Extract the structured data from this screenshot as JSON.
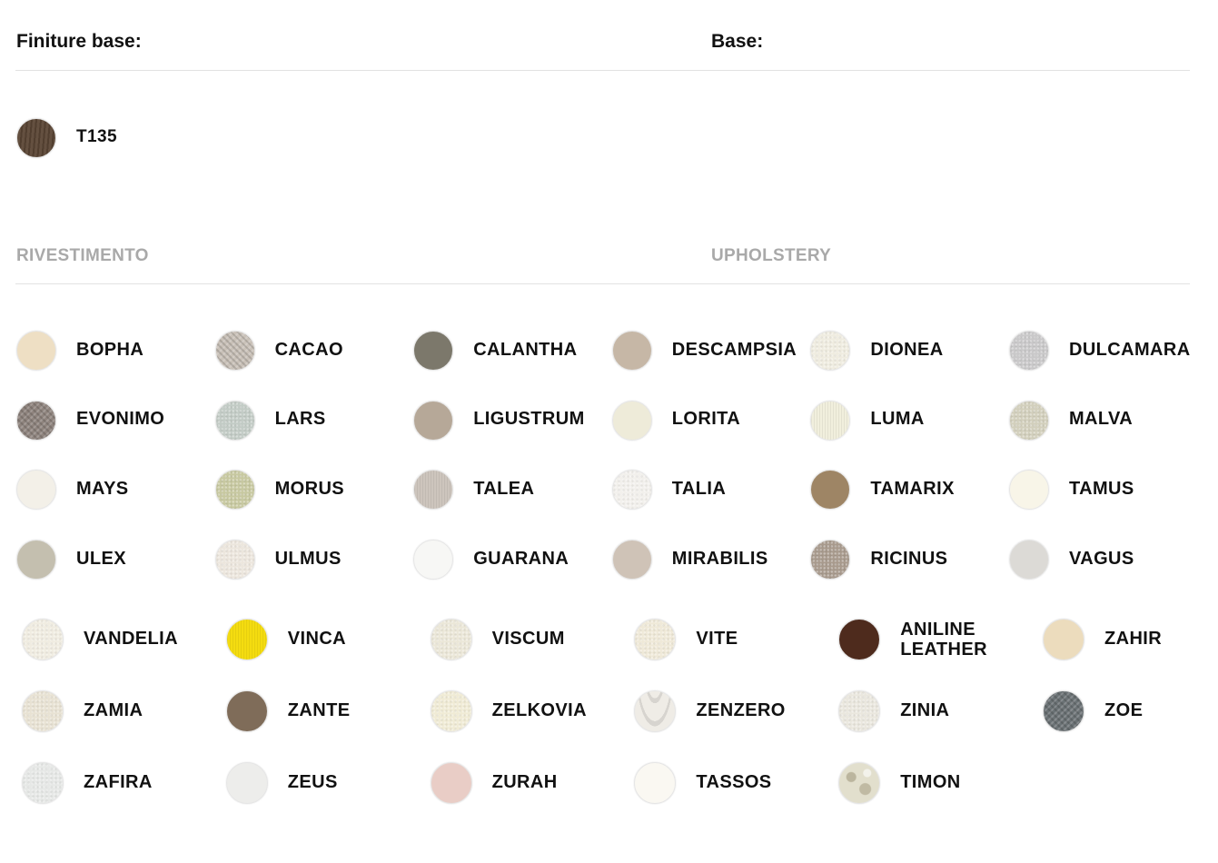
{
  "headers": {
    "finiture_base": "Finiture base:",
    "base": "Base:",
    "rivestimento": "RIVESTIMENTO",
    "upholstery": "UPHOLSTERY"
  },
  "base_finishes": [
    {
      "name": "T135",
      "color": "#5a4534",
      "texture": "wood"
    }
  ],
  "upholstery_group_a": [
    {
      "name": "BOPHA",
      "color": "#eedfc4"
    },
    {
      "name": "CACAO",
      "color": "#c9c1b8",
      "texture": "weave"
    },
    {
      "name": "CALANTHA",
      "color": "#7c786b"
    },
    {
      "name": "DESCAMPSIA",
      "color": "#c6b7a6"
    },
    {
      "name": "DIONEA",
      "color": "#efece0",
      "texture": "speckle"
    },
    {
      "name": "DULCAMARA",
      "color": "#c9c8c9",
      "texture": "speckle"
    },
    {
      "name": "EVONIMO",
      "color": "#8f847e",
      "texture": "weave"
    },
    {
      "name": "LARS",
      "color": "#c2cbc5",
      "texture": "speckle"
    },
    {
      "name": "LIGUSTRUM",
      "color": "#b6a898"
    },
    {
      "name": "LORITA",
      "color": "#eeebd9"
    },
    {
      "name": "LUMA",
      "color": "#f1efdd",
      "texture": "lines"
    },
    {
      "name": "MALVA",
      "color": "#d2cfbc",
      "texture": "speckle"
    },
    {
      "name": "MAYS",
      "color": "#f3f0e8"
    },
    {
      "name": "MORUS",
      "color": "#c7c8a0",
      "texture": "speckle"
    },
    {
      "name": "TALEA",
      "color": "#cdc5bd",
      "texture": "lines"
    },
    {
      "name": "TALIA",
      "color": "#f2f0ec",
      "texture": "speckle"
    },
    {
      "name": "TAMARIX",
      "color": "#9e8565"
    },
    {
      "name": "TAMUS",
      "color": "#f8f5e8"
    },
    {
      "name": "ULEX",
      "color": "#c4bfaf"
    },
    {
      "name": "ULMUS",
      "color": "#ece6dd",
      "texture": "speckle"
    },
    {
      "name": "GUARANA",
      "color": "#f7f7f5"
    },
    {
      "name": "MIRABILIS",
      "color": "#cfc3b7"
    },
    {
      "name": "RICINUS",
      "color": "#a89a8d",
      "texture": "speckle"
    },
    {
      "name": "VAGUS",
      "color": "#dcdad6"
    }
  ],
  "upholstery_group_b": [
    {
      "name": "VANDELIA",
      "color": "#f0ece1",
      "texture": "speckle"
    },
    {
      "name": "VINCA",
      "color": "#f4dc10",
      "texture": "lines"
    },
    {
      "name": "VISCUM",
      "color": "#ebe7d8",
      "texture": "speckle"
    },
    {
      "name": "VITE",
      "color": "#efe9d8",
      "texture": "speckle"
    },
    {
      "name": "ANILINE LEATHER",
      "color": "#4e2b1d"
    },
    {
      "name": "ZAHIR",
      "color": "#ecdcbd"
    },
    {
      "name": "ZAMIA",
      "color": "#e8e2d3",
      "texture": "speckle"
    },
    {
      "name": "ZANTE",
      "color": "#7f6c59"
    },
    {
      "name": "ZELKOVIA",
      "color": "#f0ebd5",
      "texture": "speckle"
    },
    {
      "name": "ZENZERO",
      "color": "#efece6",
      "texture": "wave"
    },
    {
      "name": "ZINIA",
      "color": "#eae7de",
      "texture": "speckle"
    },
    {
      "name": "ZOE",
      "color": "#6b7275",
      "texture": "weave"
    },
    {
      "name": "ZAFIRA",
      "color": "#e6e8e6",
      "texture": "speckle"
    },
    {
      "name": "ZEUS",
      "color": "#ededeb"
    },
    {
      "name": "ZURAH",
      "color": "#e9cdc6"
    },
    {
      "name": "TASSOS",
      "color": "#faf8f2"
    },
    {
      "name": "TIMON",
      "color": "#e2dfcd",
      "texture": "camo"
    }
  ]
}
